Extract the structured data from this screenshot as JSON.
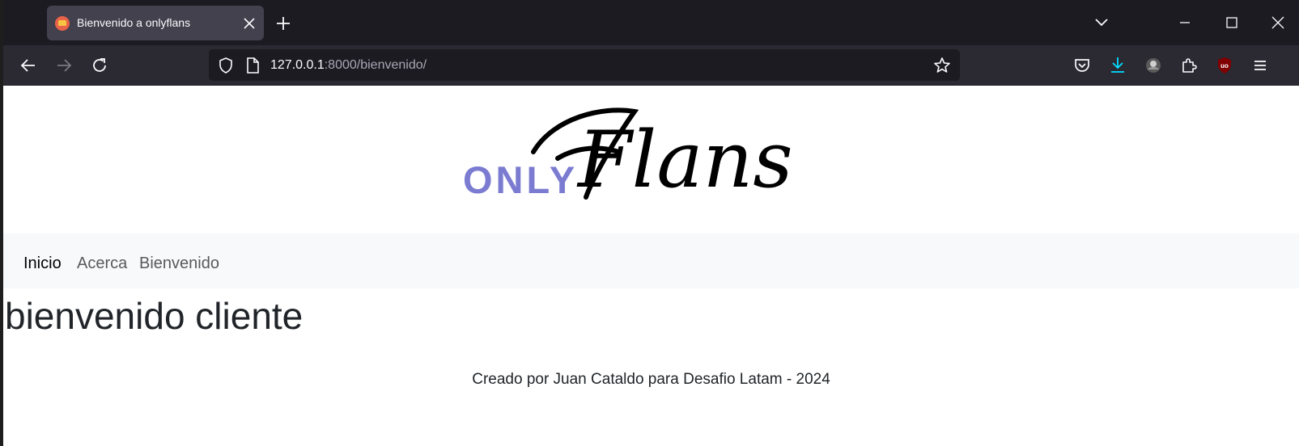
{
  "browser": {
    "tab_title": "Bienvenido a onlyflans",
    "url_host": "127.0.0.1",
    "url_rest": ":8000/bienvenido/",
    "accent_color": "#00ddff"
  },
  "site": {
    "logo_only": "ONLY",
    "logo_flans": "Flans",
    "logo_only_color": "#7b7bd1",
    "nav": {
      "inicio": "Inicio",
      "acerca": "Acerca",
      "bienvenido": "Bienvenido"
    },
    "heading": "bienvenido cliente",
    "footer": "Creado por Juan Cataldo para Desafio Latam - 2024"
  },
  "icons": [
    "flan-favicon-icon",
    "close-tab-icon",
    "new-tab-icon",
    "tab-list-icon",
    "minimize-icon",
    "maximize-icon",
    "close-window-icon",
    "back-icon",
    "forward-icon",
    "reload-icon",
    "shield-icon",
    "page-icon",
    "bookmark-star-icon",
    "pocket-icon",
    "download-icon",
    "account-icon",
    "extensions-icon",
    "ublock-icon",
    "menu-icon"
  ]
}
